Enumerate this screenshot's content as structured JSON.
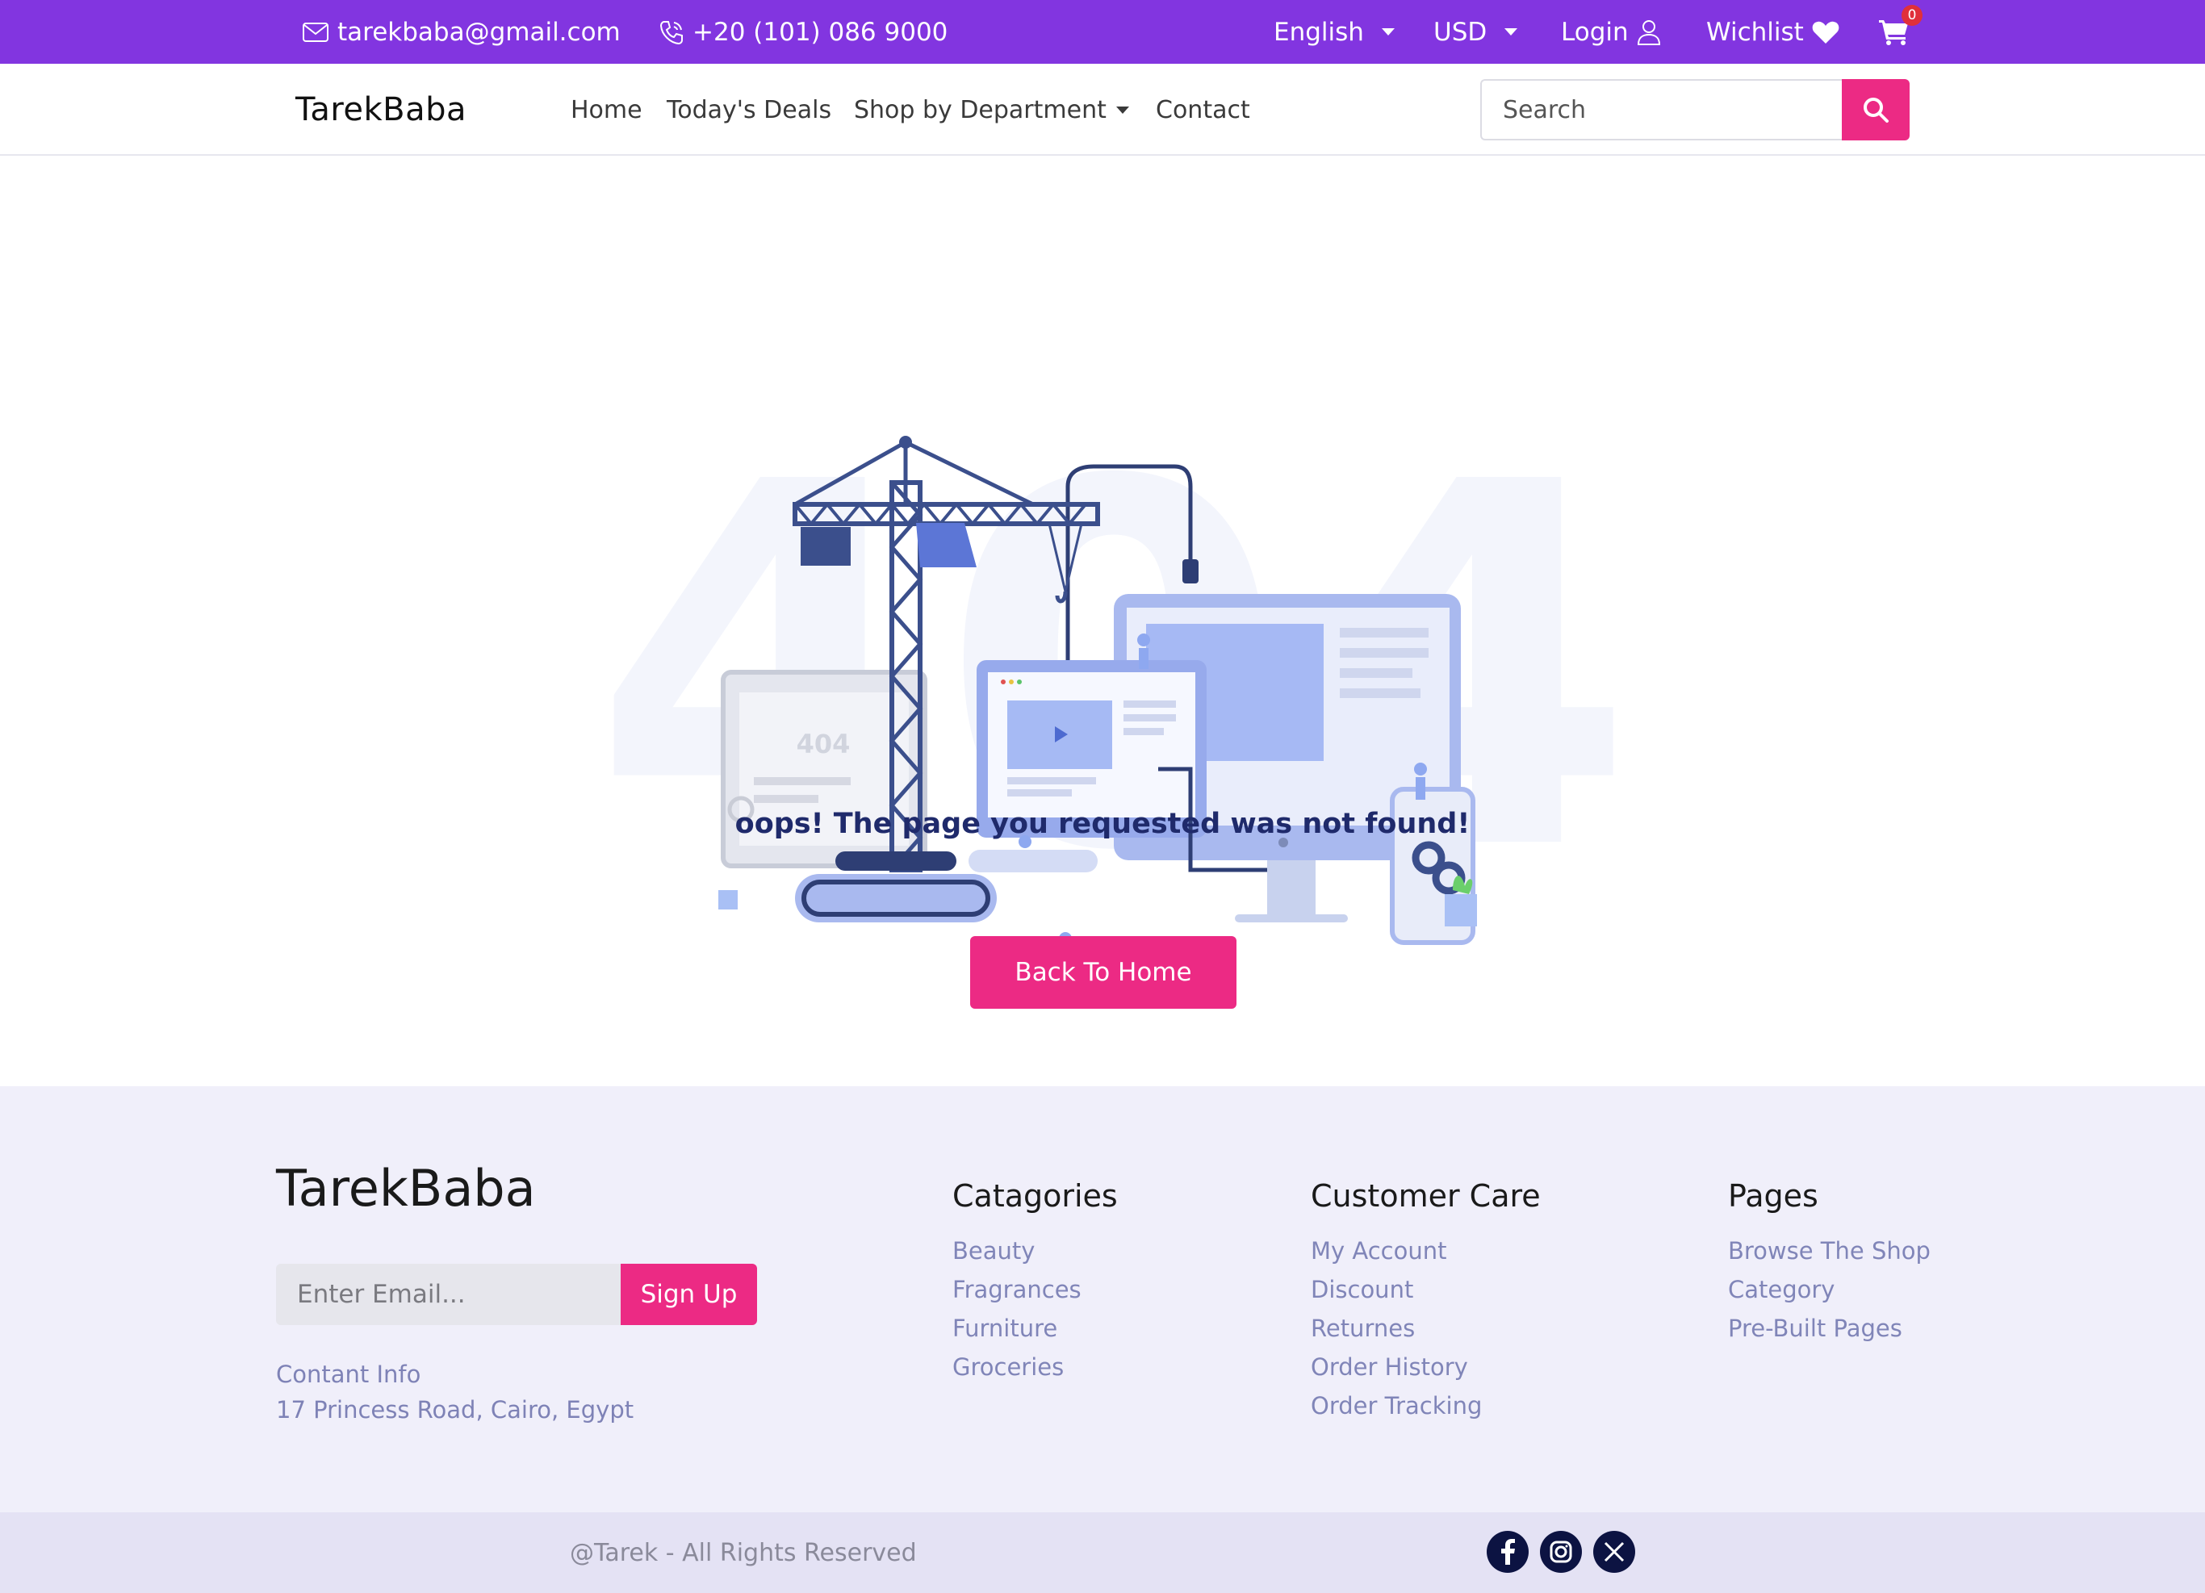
{
  "topbar": {
    "email": "tarekbaba@gmail.com",
    "phone": "+20 (101) 086 9000",
    "language": "English",
    "currency": "USD",
    "login": "Login",
    "wishlist": "Wichlist",
    "cart_count": "0"
  },
  "navbar": {
    "brand": "TarekBaba",
    "links": [
      "Home",
      "Today's Deals",
      "Shop by Department",
      "Contact"
    ],
    "search_placeholder": "Search"
  },
  "error": {
    "bg_text": "404",
    "screen_text": "404",
    "message": "oops! The page you requested was not found!",
    "button": "Back To Home"
  },
  "footer": {
    "brand": "TarekBaba",
    "email_placeholder": "Enter Email...",
    "signup": "Sign Up",
    "contact_title": "Contant Info",
    "contact_address": "17 Princess Road, Cairo, Egypt",
    "columns": [
      {
        "title": "Catagories",
        "links": [
          "Beauty",
          "Fragrances",
          "Furniture",
          "Groceries"
        ]
      },
      {
        "title": "Customer Care",
        "links": [
          "My Account",
          "Discount",
          "Returnes",
          "Order History",
          "Order Tracking"
        ]
      },
      {
        "title": "Pages",
        "links": [
          "Browse The Shop",
          "Category",
          "Pre-Built Pages"
        ]
      }
    ],
    "copyright": "@Tarek - All Rights Reserved"
  },
  "icons": [
    "envelope-icon",
    "phone-icon",
    "user-icon",
    "heart-icon",
    "cart-icon",
    "search-icon",
    "facebook-icon",
    "instagram-icon",
    "x-icon"
  ],
  "colors": {
    "topbar": "#8235e0",
    "accent": "#ec2a84",
    "message": "#1f2a6b",
    "footer_bg": "#f0effa",
    "footer_link": "#8085b8",
    "social": "#0c1342"
  }
}
